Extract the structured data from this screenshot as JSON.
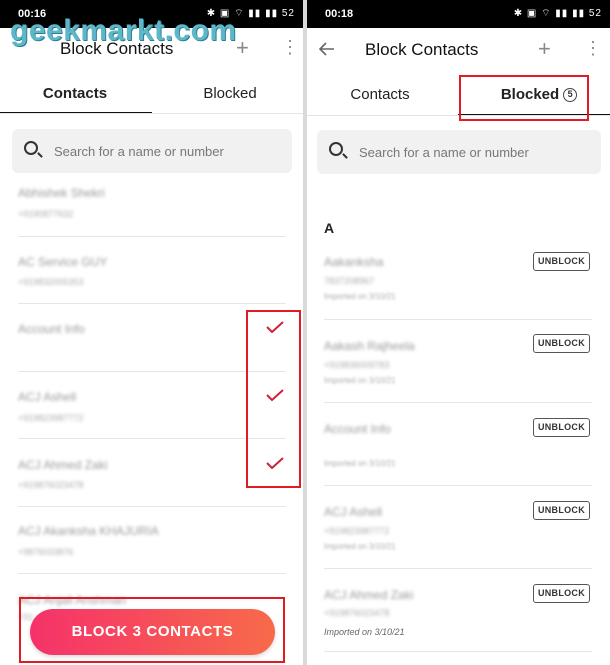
{
  "left": {
    "status_time": "00:16",
    "status_icons": "✱ ▣ ⌔ ▮▮ ▮▮ 52",
    "title": "Block Contacts",
    "watermark": "geekmarkt.com",
    "tabs": [
      "Contacts",
      "Blocked"
    ],
    "search_placeholder": "Search for a name or number",
    "contacts": [
      {
        "name": "Abhishek Shekri",
        "number": "+9190877632"
      },
      {
        "name": "AC Service GUY",
        "number": "+919832005353"
      },
      {
        "name": "Account Info",
        "number": ""
      },
      {
        "name": "ACJ Ashell",
        "number": "+919823987772"
      },
      {
        "name": "ACJ Ahmed Zaki",
        "number": "+919876023478"
      },
      {
        "name": "ACJ Akanksha KHAJURIA",
        "number": "+9876033876"
      },
      {
        "name": "ACJ Anjali Anshman",
        "number": "+91"
      }
    ],
    "block_button": "BLOCK 3 CONTACTS"
  },
  "right": {
    "status_time": "00:18",
    "status_icons": "✱ ▣ ⌔ ▮▮ ▮▮ 52",
    "title": "Block Contacts",
    "tabs": [
      "Contacts",
      "Blocked"
    ],
    "blocked_count": "5",
    "search_placeholder": "Search for a name or number",
    "section_letter": "A",
    "blocked": [
      {
        "name": "Aakanksha",
        "number": "7837208967",
        "imported": "Imported on 3/10/21"
      },
      {
        "name": "Aakash Rajheela",
        "number": "+919836009783",
        "imported": "Imported on 3/10/21"
      },
      {
        "name": "Account Info",
        "number": "",
        "imported": "Imported on 3/10/21"
      },
      {
        "name": "ACJ Ashell",
        "number": "+919823987772",
        "imported": "Imported on 3/10/21"
      },
      {
        "name": "ACJ Ahmed Zaki",
        "number": "+919876023478",
        "imported": "Imported on 3/10/21"
      }
    ],
    "unblock_label": "UNBLOCK"
  }
}
